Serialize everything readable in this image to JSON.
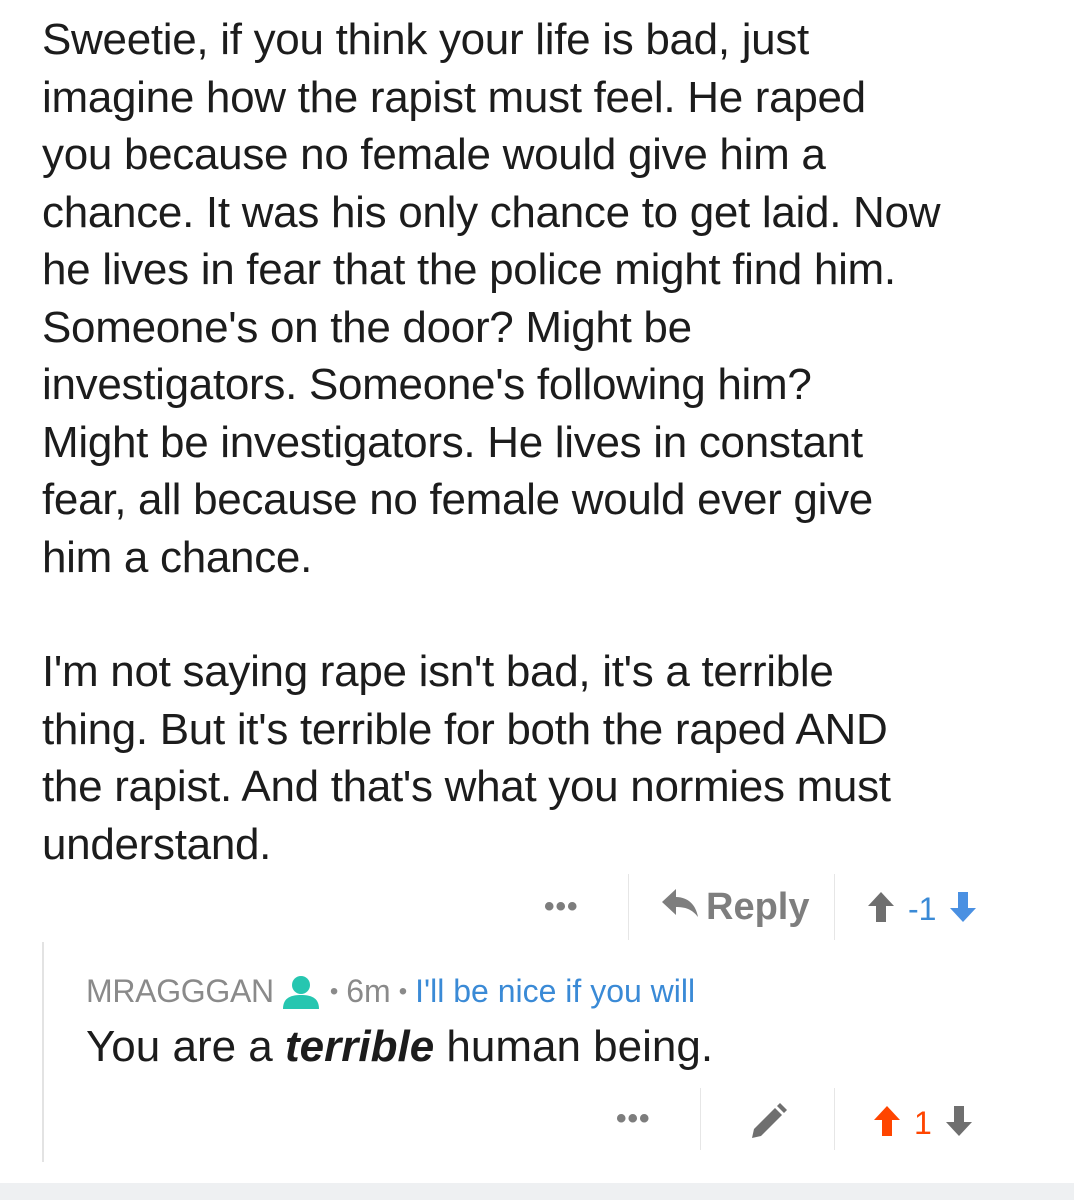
{
  "parent_comment": {
    "paragraph_1": "Sweetie, if you think your life is bad, just\nimagine how the rapist must feel. He raped\nyou because no female would give him a\nchance. It was his only chance to get laid. Now\nhe lives in fear that the police might find him.\nSomeone's on the door? Might be\ninvestigators. Someone's following him?\nMight be investigators. He lives in constant\nfear, all because no female would ever give\nhim a chance.",
    "paragraph_2": "I'm not saying rape isn't bad, it's a terrible\nthing. But it's terrible for both the raped AND\nthe rapist. And that's what you normies must\nunderstand.",
    "more_label": "•••",
    "reply_label": "Reply",
    "score": "-1",
    "score_color": "#3a8ad6",
    "upvote_icon": "arrow-up-icon",
    "downvote_icon": "arrow-down-icon",
    "upvote_state": "neutral",
    "downvote_state": "active"
  },
  "child_comment": {
    "author": "MRAGGGAN",
    "author_icon": "user-icon",
    "author_icon_color": "#26c6b0",
    "separator": "•",
    "time": "6m",
    "flair": "I'll be nice if you will",
    "flair_color": "#3a8ad6",
    "body_before": "You are a ",
    "body_emphasis": "terrible",
    "body_after": " human being.",
    "more_label": "•••",
    "edit_icon": "pencil-icon",
    "score": "1",
    "score_color": "#ff4500",
    "upvote_state": "active",
    "downvote_state": "neutral"
  }
}
